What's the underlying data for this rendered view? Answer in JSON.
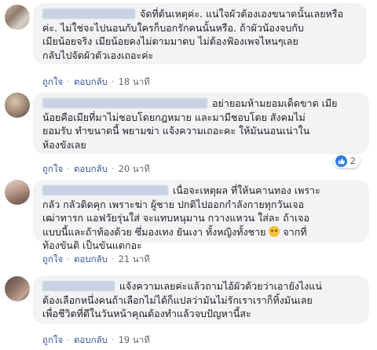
{
  "comments": [
    {
      "text": "จัดที่ต้นเหตุค่ะ. แน่ใจผัวต้องเองขนาดนั้นเลยหรือ\nค่ะ. ไม่ใช่จะไปนอนกับใครก็บอกรักคนนั้นหรือ. ถ้าผัวน้องจบกับ\nเมียน้อยจริง เมียน้อยคงไม่ตามมาตบ ไม่ต้องฟ้องเพจไหนๆเลย\nกลับไปจัดผัวตัวเองเถอะค่ะ",
      "like": "ถูกใจ",
      "reply": "ตอบกลับ",
      "time": "18 นาที"
    },
    {
      "text": "อย่ายอมห้ามยอมเด็ดขาด เมีย\nน้อยคือเมียที่มาไม่ชอบโดยกฎหมาย และมามีชอบโดย สังคมไม่\nยอมรับ ทำขนาดนี้ พยามฆ่า แจ้งความเถอะคะ ให้มันนอนเน่าใน\nห้องขังเลย",
      "like": "ถูกใจ",
      "reply": "ตอบกลับ",
      "time": "20 นาที",
      "reaction_count": "2"
    },
    {
      "text": "เนื่อจะเหตุผล ที่ให้นคานทอง เพราะ\nกลัว กลัวติดคุก เพราะฆ่า ผู้ชาย ปกติไปออกกำลังกายทุกวันเจอ\nเฒ่าทารก แอฟวัยรุ่นใส่ จะแทบหนุมาน กวางแหวน ใส่ละ ถ้าเจอ\nแบบนี้และถ้าท้องด้วย ซึ่มองเทง ยันเงา ทั้งหญิงทั้งชาย",
      "text_after_emoji": " จากที่\nท้องขันติ เป็นขันแตกอะ",
      "like": "ถูกใจ",
      "reply": "ตอบกลับ",
      "time": "21 นาที"
    },
    {
      "text": "แจ้งความเลยค่ะแล้วถามไอ้ผัวด้วยว่าเอายังไงแน่\nต้องเลือกหนึ่งคนถ้าเลือกไม่ได้ก็แปลว่ามันไม่รักเราเราก็ทิ้งมันเลย\nเพื่อชีวิตที่ดีในวันหน้าคุณต้องทำแล้วจบปัญหานี้สะ",
      "like": "ถูกใจ",
      "reply": "ตอบกลับ",
      "time": "19 นาที"
    }
  ],
  "colors": {
    "bubble": "#f2f3f5",
    "link": "#385898",
    "like_badge": "#2e7be4"
  }
}
